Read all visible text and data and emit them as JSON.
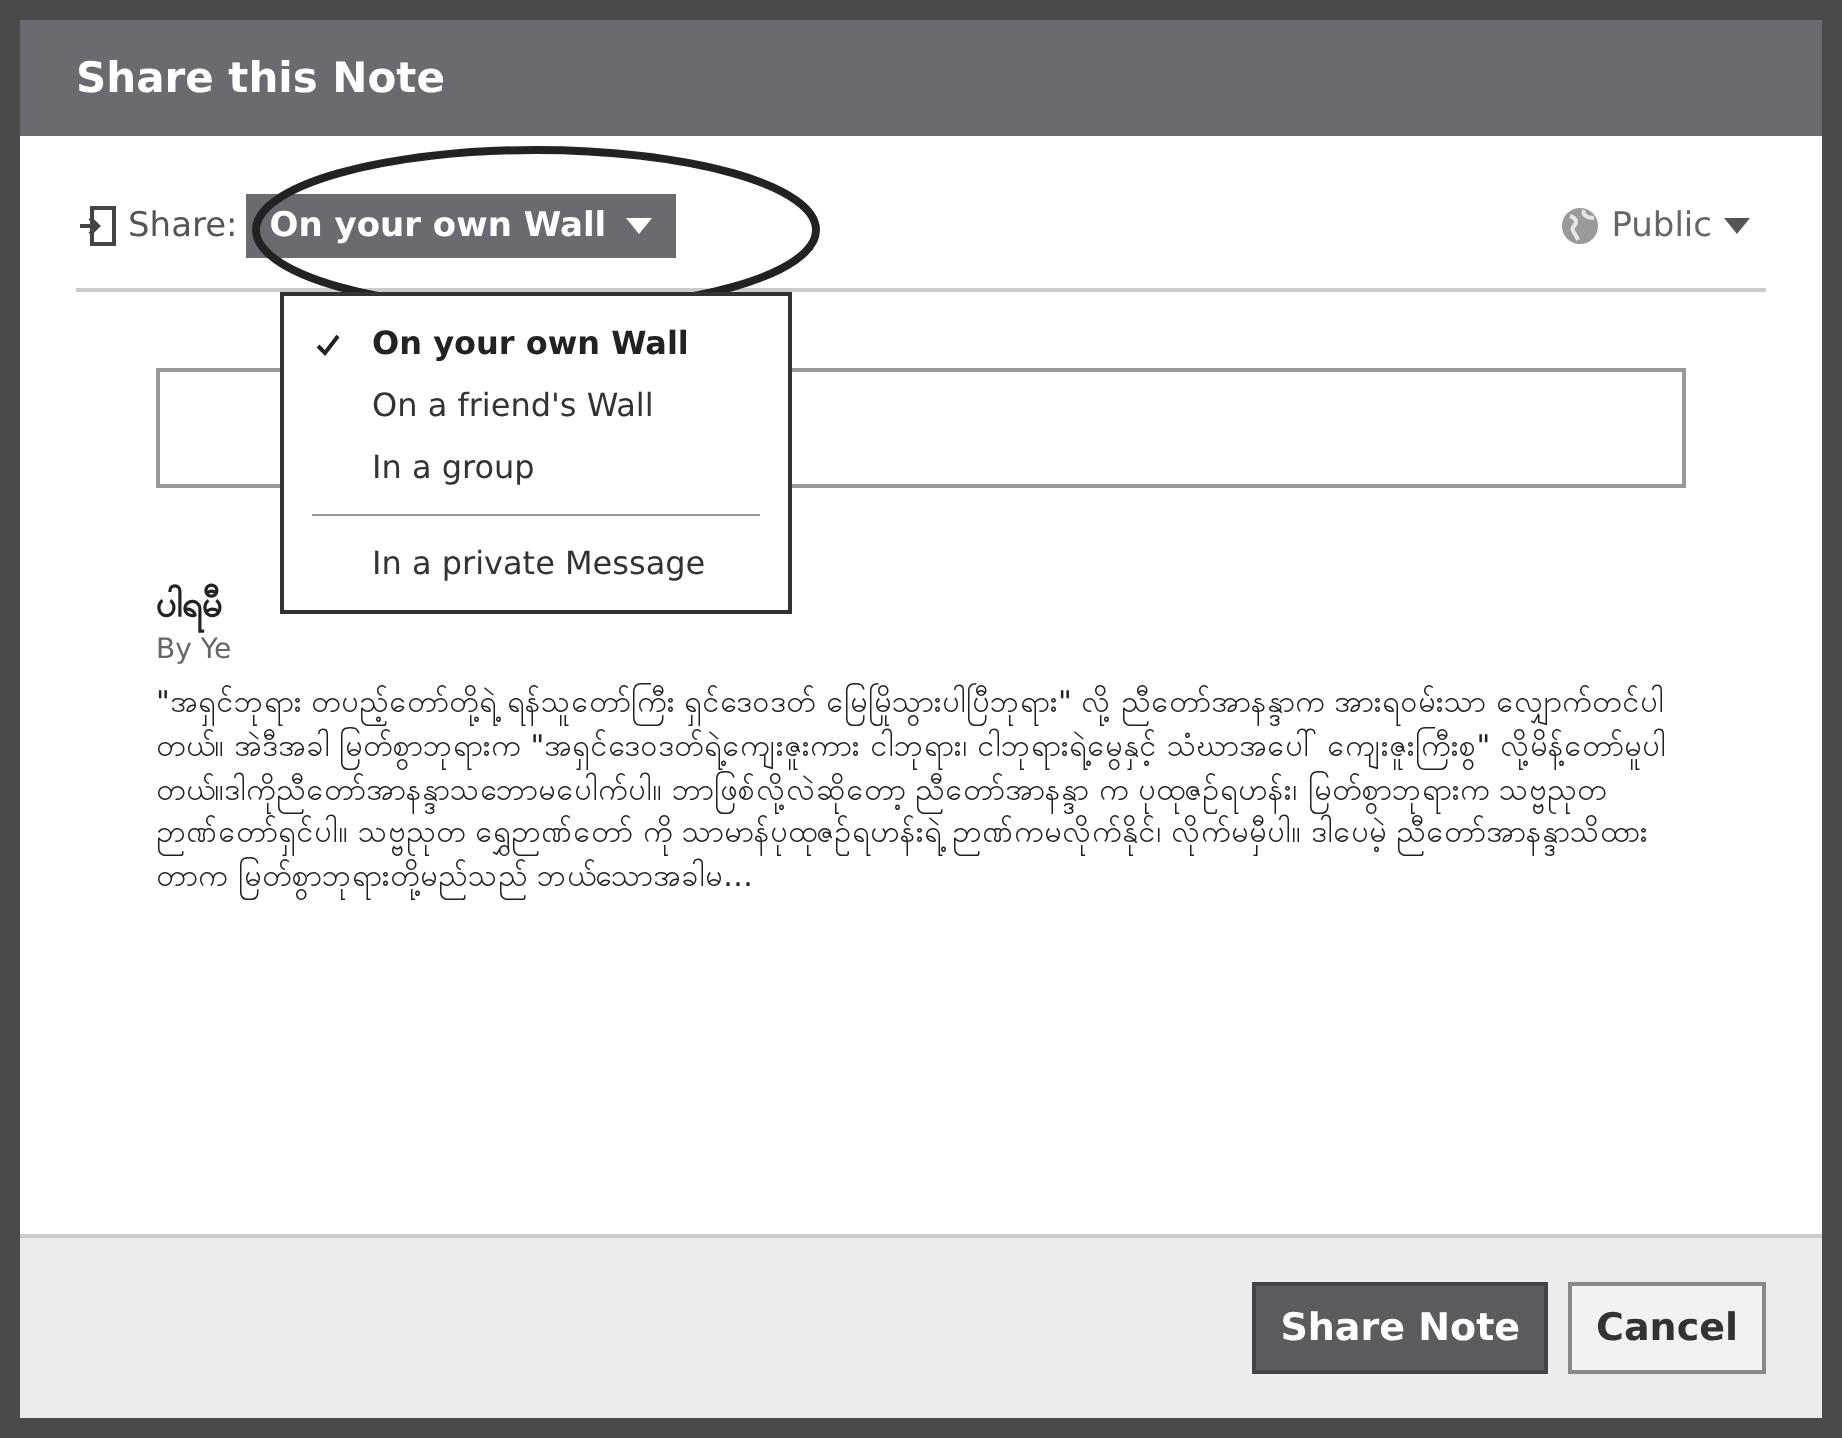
{
  "dialog": {
    "title": "Share this Note"
  },
  "share_bar": {
    "label": "Share:",
    "destination": "On your own Wall",
    "audience": "Public"
  },
  "destination_menu": {
    "sections": [
      [
        {
          "label": "On your own Wall",
          "selected": true
        },
        {
          "label": "On a friend's Wall",
          "selected": false
        },
        {
          "label": "In a group",
          "selected": false
        }
      ],
      [
        {
          "label": "In a private Message",
          "selected": false
        }
      ]
    ]
  },
  "note": {
    "title": "ပါရမီ",
    "author": "By Ye",
    "excerpt": "\"အရှင်ဘုရား တပည့်တော်တို့ရဲ့ ရန်သူတော်ကြီး ရှင်ဒေဝဒတ် မြေမြိုသွားပါပြီဘုရား\" လို့ ညီတော်အာနန္ဒာက အားရဝမ်းသာ လျှောက်တင်ပါတယ်။ အဲဒီအခါ မြတ်စွာဘုရားက \"အရှင်ဒေဝဒတ်ရဲ့ကျေးဇူးကား ငါဘုရား၊ ငါဘုရားရဲ့မွေနှင့် သံဃာအပေါ် ကျေးဇူးကြီးစွ\" လို့မိန့်တော်မူပါတယ်။ဒါကိုညီတော်အာနန္ဒာသဘောမပေါက်ပါ။ ဘာဖြစ်လို့လဲဆိုတော့ ညီတော်အာနန္ဒာ က ပုထုဇဉ်ရဟန်း၊ မြတ်စွာဘုရားက သဗ္ဗညုတ ဉာဏ်တော်ရှင်ပါ။ သဗ္ဗညုတ ရွှေဉာဏ်တော် ကို သာမာန်ပုထုဇဉ်ရဟန်းရဲ့ ဉာဏ်ကမလိုက်နိုင်၊ လိုက်မမှီပါ။ ဒါပေမဲ့ ညီတော်အာနန္ဒာသိထားတာက မြတ်စွာဘုရားတို့မည်သည် ဘယ်သောအခါမ…"
  },
  "buttons": [
    {
      "label": "Share Note",
      "kind": "primary"
    },
    {
      "label": "Cancel",
      "kind": "secondary"
    }
  ]
}
